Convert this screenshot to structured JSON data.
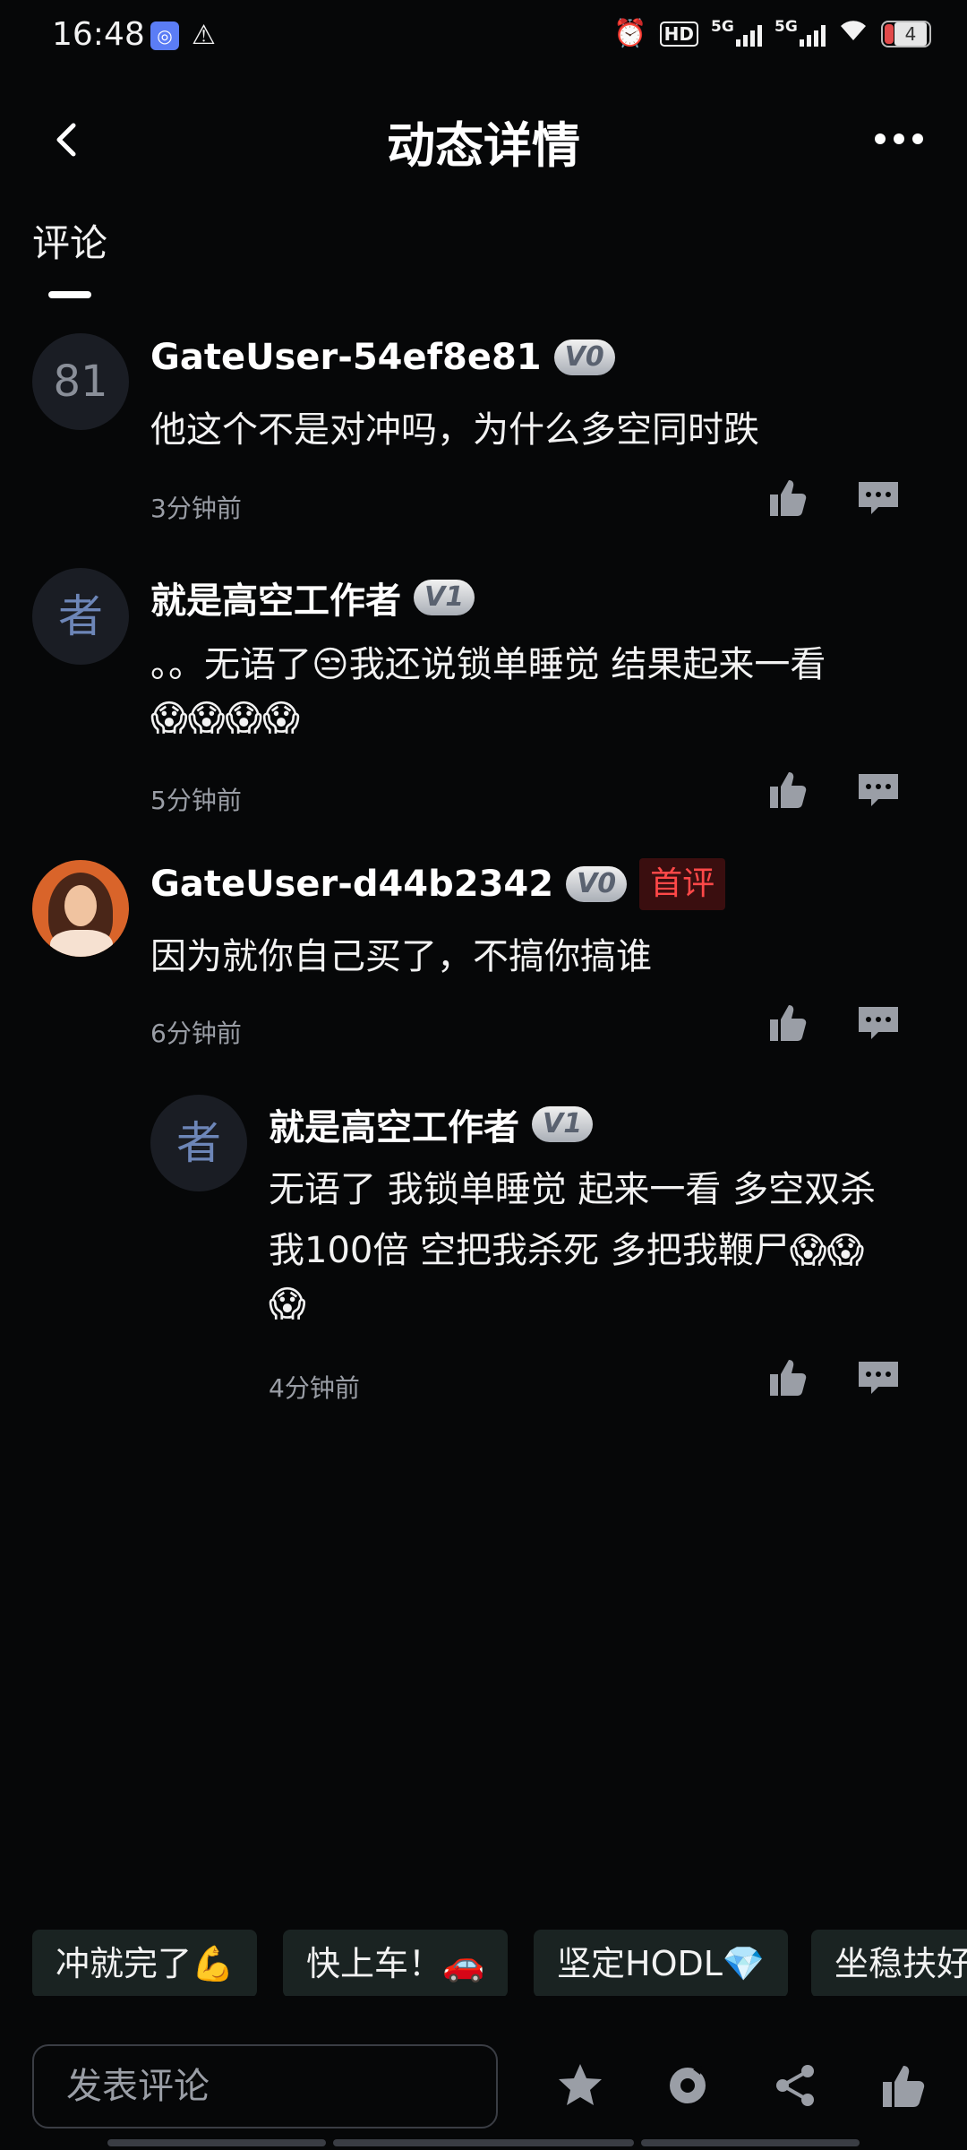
{
  "status_bar": {
    "time": "16:48",
    "app_icon": "vpn-app-icon",
    "warning_icon": "warning-icon",
    "hd_label": "HD",
    "signal1_label": "5G",
    "signal2_label": "5G",
    "battery_level": "4"
  },
  "header": {
    "title": "动态详情",
    "back_icon": "chevron-left-icon",
    "more_icon": "more-horizontal-icon"
  },
  "tabs": [
    {
      "label": "评论",
      "active": true
    }
  ],
  "comments": [
    {
      "avatar_text": "81",
      "username": "GateUser-54ef8e81",
      "vip": "V0",
      "content": "他这个不是对冲吗，为什么多空同时跌",
      "time": "3分钟前"
    },
    {
      "avatar_text": "者",
      "username": "就是高空工作者",
      "vip": "V1",
      "content_line1": "。。无语了😒我还说锁单睡觉 结果起来一看",
      "content_line2": "😱😱😱😱",
      "time": "5分钟前"
    },
    {
      "avatar_text": "",
      "username": "GateUser-d44b2342",
      "vip": "V0",
      "badge": "首评",
      "content": "因为就你自己买了，不搞你搞谁",
      "time": "6分钟前"
    }
  ],
  "reply": {
    "avatar_text": "者",
    "username": "就是高空工作者",
    "vip": "V1",
    "content_line1": "无语了 我锁单睡觉 起来一看 多空双杀",
    "content_line2": "我100倍 空把我杀死 多把我鞭尸😱😱",
    "content_line3": "😱",
    "time": "4分钟前"
  },
  "quick_replies": [
    "冲就完了💪",
    "快上车！🚗",
    "坚定HODL💎",
    "坐稳扶好"
  ],
  "bottom_bar": {
    "input_placeholder": "发表评论",
    "icons": [
      "star-icon",
      "repost-icon",
      "share-icon",
      "thumbs-up-icon"
    ]
  },
  "colors": {
    "background": "#060708",
    "text_secondary": "#9a9ea6",
    "badge_red": "#ff4848",
    "chip_bg": "#1a2322"
  }
}
